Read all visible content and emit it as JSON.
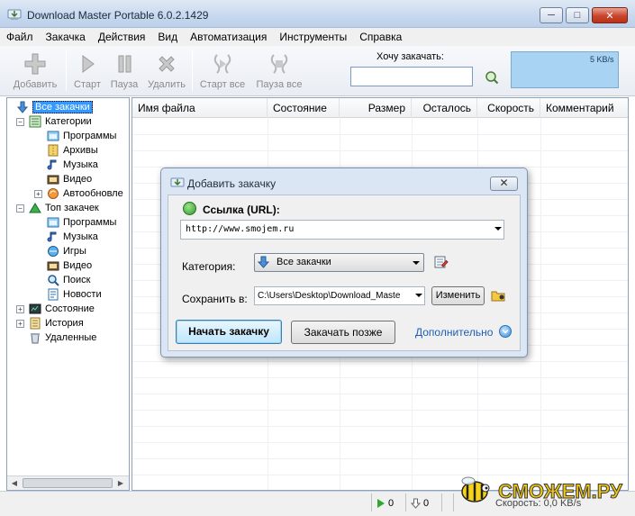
{
  "window": {
    "title": "Download Master Portable 6.0.2.1429"
  },
  "menu": [
    "Файл",
    "Закачка",
    "Действия",
    "Вид",
    "Автоматизация",
    "Инструменты",
    "Справка"
  ],
  "toolbar": {
    "add": "Добавить",
    "start": "Старт",
    "pause": "Пауза",
    "delete": "Удалить",
    "start_all": "Старт все",
    "pause_all": "Пауза все",
    "want_label": "Хочу закачать:",
    "speed": "5 KB/s"
  },
  "tree": {
    "all": "Все закачки",
    "categories": "Категории",
    "programs": "Программы",
    "archives": "Архивы",
    "music": "Музыка",
    "video": "Видео",
    "autoupdate": "Автообновле",
    "top": "Топ закачек",
    "top_programs": "Программы",
    "top_music": "Музыка",
    "top_games": "Игры",
    "top_video": "Видео",
    "top_search": "Поиск",
    "top_news": "Новости",
    "state": "Состояние",
    "history": "История",
    "deleted": "Удаленные"
  },
  "list": {
    "columns": [
      "Имя файла",
      "Состояние",
      "Размер",
      "Осталось",
      "Скорость",
      "Комментарий"
    ]
  },
  "dialog": {
    "title": "Добавить закачку",
    "url_label": "Ссылка (URL):",
    "url_value": "http://www.smojem.ru",
    "category_label": "Категория:",
    "category_value": "Все закачки",
    "save_label": "Сохранить в:",
    "save_value": "C:\\Users\\Desktop\\Download_Maste",
    "change_button": "Изменить",
    "start_button": "Начать закачку",
    "later_button": "Закачать позже",
    "more_link": "Дополнительно"
  },
  "status": {
    "active": "0",
    "downloaded": "0",
    "speed_text": "Скорость: 0,0 KB/s"
  },
  "watermark": "СМОЖЕМ.РУ"
}
